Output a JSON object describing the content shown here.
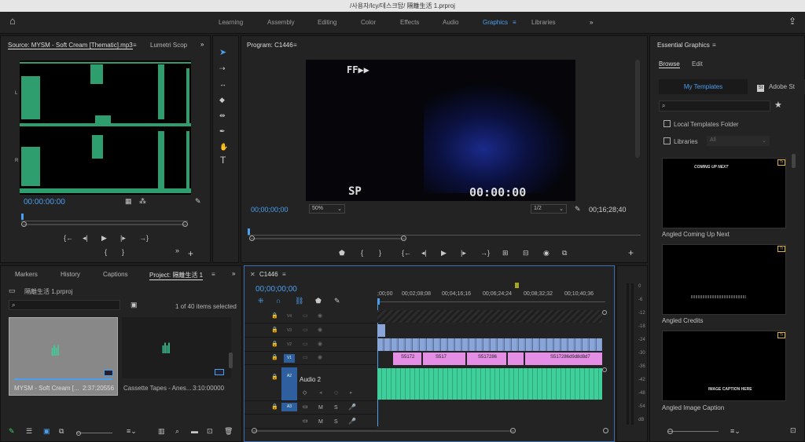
{
  "title": "/사용자/lcy/데스크탑/ 隔離生活 1.prproj",
  "workspaces": [
    "Learning",
    "Assembly",
    "Editing",
    "Color",
    "Effects",
    "Audio",
    "Graphics",
    "Libraries"
  ],
  "active_workspace": "Graphics",
  "source": {
    "tab": "Source: MYSM - Soft Cream [Thematic].mp3",
    "tab2": "Lumetri Scop",
    "timecode": "00:00:00:00",
    "ch_l": "L",
    "ch_r": "R"
  },
  "program": {
    "tab": "Program: C1446",
    "overlay_top": "FF▶▶",
    "overlay_sp": "SP",
    "overlay_tc": "00:00:00",
    "timecode": "00;00;00;00",
    "zoom": "50%",
    "resolution": "1/2",
    "duration": "00;16;28;40"
  },
  "project": {
    "tabs": [
      "Markers",
      "History",
      "Captions",
      "Project: 隔離生活 1"
    ],
    "file": "隔離生活 1.prproj",
    "count": "1 of 40 items selected",
    "items": [
      {
        "name": "MYSM - Soft Cream [...",
        "dur": "2:37:20556"
      },
      {
        "name": "Cassette Tapes - Anes...",
        "dur": "3:10:00000"
      }
    ]
  },
  "timeline": {
    "tab": "C1446",
    "timecode": "00;00;00;00",
    "ruler": [
      ";00;00",
      "00;02;08;08",
      "00;04;16;16",
      "00;06;24;24",
      "00;08;32;32",
      "00;10;40;36"
    ],
    "tracks": [
      "V4",
      "V3",
      "V2",
      "V1",
      "A2",
      "A3"
    ],
    "audio_track_name": "Audio 2",
    "clips": [
      "S5172",
      "S517",
      "S517286",
      "S517286d9d8d8d7"
    ],
    "mute": "M",
    "solo": "S"
  },
  "meter": {
    "labels": [
      "0",
      "-6",
      "-12",
      "-18",
      "-24",
      "-30",
      "-36",
      "-42",
      "-48",
      "-54",
      "dB"
    ]
  },
  "essential": {
    "title": "Essential Graphics",
    "tabs": [
      "Browse",
      "Edit"
    ],
    "my_templates": "My Templates",
    "adobe_stock": "Adobe St",
    "local_templates": "Local Templates Folder",
    "libraries": "Libraries",
    "libraries_select": "All",
    "templates": [
      {
        "name": "Angled Coming Up Next",
        "overlay": "COMING UP NEXT"
      },
      {
        "name": "Angled Credits",
        "overlay": ""
      },
      {
        "name": "Angled Image Caption",
        "overlay": "IMAGE CAPTION HERE"
      }
    ]
  },
  "colors": {
    "accent": "#4b9ff0",
    "audio_clip": "#3fcf9a",
    "video_clip": "#8aa6d8",
    "pink_clip": "#e58ee5",
    "waveform": "#2e9e6e"
  }
}
